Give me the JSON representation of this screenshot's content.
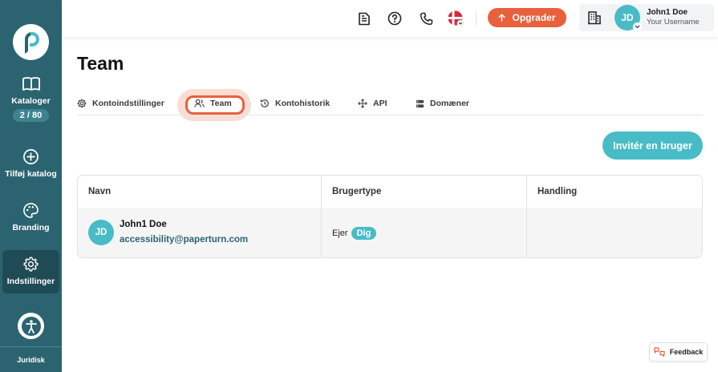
{
  "sidebar": {
    "items": [
      {
        "label": "Kataloger",
        "count": "2 / 80",
        "icon": "book-open-icon"
      },
      {
        "label": "Tilføj katalog",
        "icon": "plus-circle-icon"
      },
      {
        "label": "Branding",
        "icon": "palette-icon"
      },
      {
        "label": "Indstillinger",
        "icon": "gear-icon",
        "active": true
      }
    ],
    "legal": "Juridisk"
  },
  "header": {
    "upgrade_label": "Opgrader",
    "user_initials": "JD",
    "user_name": "John1 Doe",
    "user_sub": "Your Username",
    "language_flag": "danish-flag-icon"
  },
  "page": {
    "title": "Team"
  },
  "tabs": [
    {
      "label": "Kontoindstillinger",
      "icon": "gear-icon"
    },
    {
      "label": "Team",
      "icon": "users-icon",
      "active": true
    },
    {
      "label": "Kontohistorik",
      "icon": "history-icon"
    },
    {
      "label": "API",
      "icon": "move-arrows-icon"
    },
    {
      "label": "Domæner",
      "icon": "server-icon"
    }
  ],
  "invite_label": "Invitér en bruger",
  "table": {
    "columns": [
      "Navn",
      "Brugertype",
      "Handling"
    ],
    "rows": [
      {
        "initials": "JD",
        "name": "John1 Doe",
        "email": "accessibility@paperturn.com",
        "type": "Ejer",
        "badge": "Dig"
      }
    ]
  },
  "feedback_label": "Feedback",
  "colors": {
    "sidebar": "#2b6470",
    "accent": "#48bcc6",
    "upgrade": "#e8603c"
  }
}
